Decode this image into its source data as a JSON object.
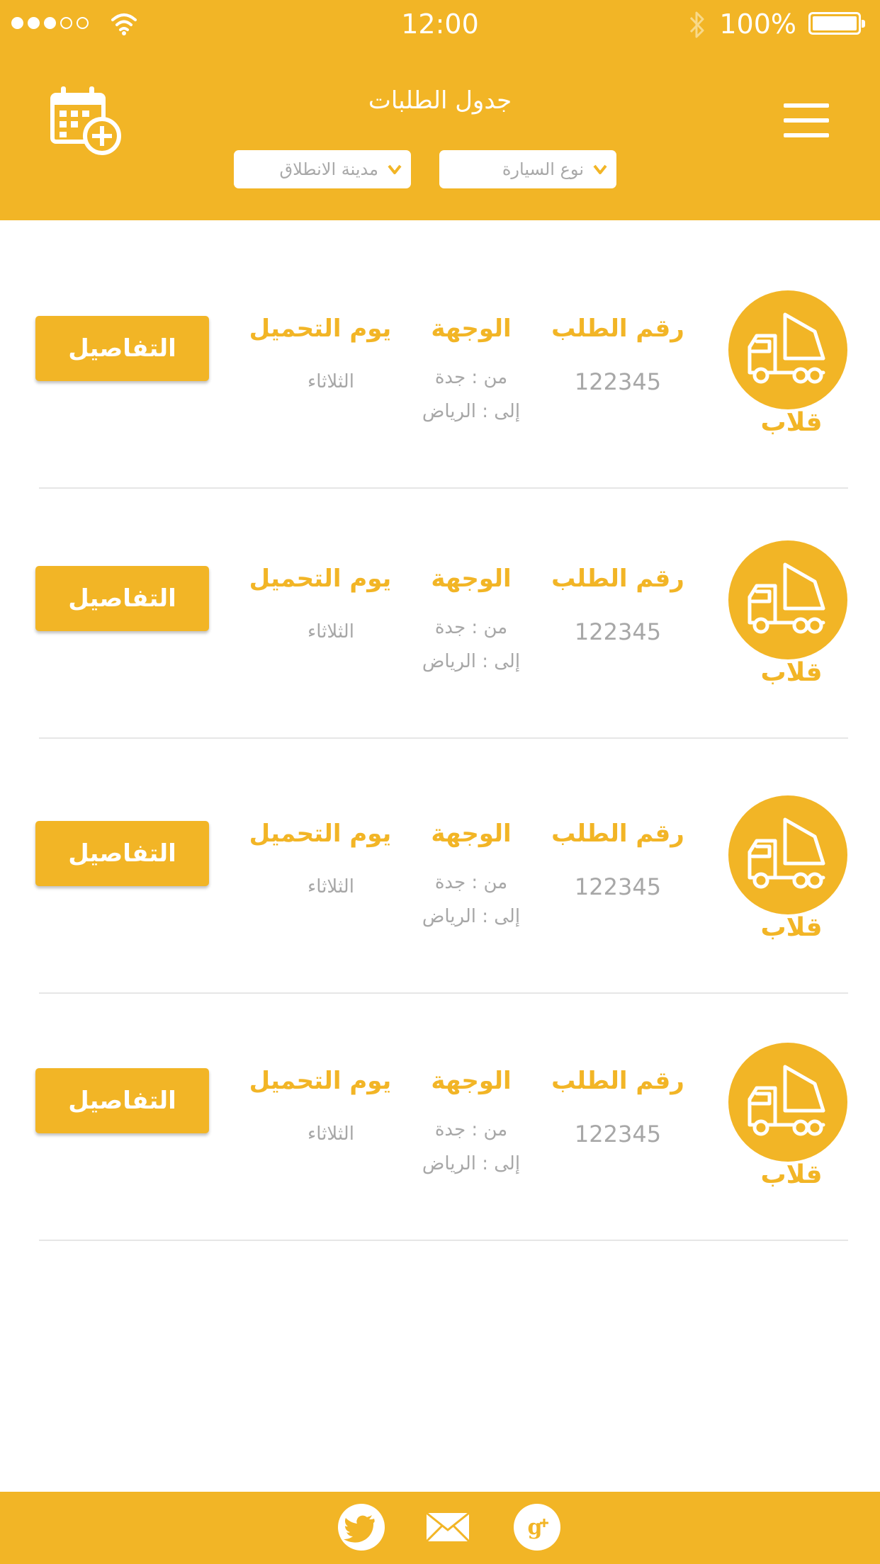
{
  "status_bar": {
    "time": "12:00",
    "battery": "100%",
    "signal_dots": 5,
    "signal_filled": 3
  },
  "header": {
    "title": "جدول الطلبات",
    "filters": {
      "departure_city": "مدينة الانطلاق",
      "vehicle_type": "نوع السيارة"
    }
  },
  "orders": [
    {
      "vehicle_label": "قلاب",
      "order_number_label": "رقم الطلب",
      "order_number": "122345",
      "destination_label": "الوجهة",
      "from": "من : جدة",
      "to": "إلى : الرياض",
      "loading_day_label": "يوم التحميل",
      "loading_day": "الثلاثاء",
      "details_button": "التفاصيل"
    },
    {
      "vehicle_label": "قلاب",
      "order_number_label": "رقم الطلب",
      "order_number": "122345",
      "destination_label": "الوجهة",
      "from": "من : جدة",
      "to": "إلى : الرياض",
      "loading_day_label": "يوم التحميل",
      "loading_day": "الثلاثاء",
      "details_button": "التفاصيل"
    },
    {
      "vehicle_label": "قلاب",
      "order_number_label": "رقم الطلب",
      "order_number": "122345",
      "destination_label": "الوجهة",
      "from": "من : جدة",
      "to": "إلى : الرياض",
      "loading_day_label": "يوم التحميل",
      "loading_day": "الثلاثاء",
      "details_button": "التفاصيل"
    },
    {
      "vehicle_label": "قلاب",
      "order_number_label": "رقم الطلب",
      "order_number": "122345",
      "destination_label": "الوجهة",
      "from": "من : جدة",
      "to": "إلى : الرياض",
      "loading_day_label": "يوم التحميل",
      "loading_day": "الثلاثاء",
      "details_button": "التفاصيل"
    }
  ],
  "footer": {
    "icons": [
      "twitter-icon",
      "mail-icon",
      "google-plus-icon"
    ]
  },
  "colors": {
    "accent": "#f2b526",
    "muted_text": "#a7a7a7",
    "divider": "#e6e6e6"
  }
}
